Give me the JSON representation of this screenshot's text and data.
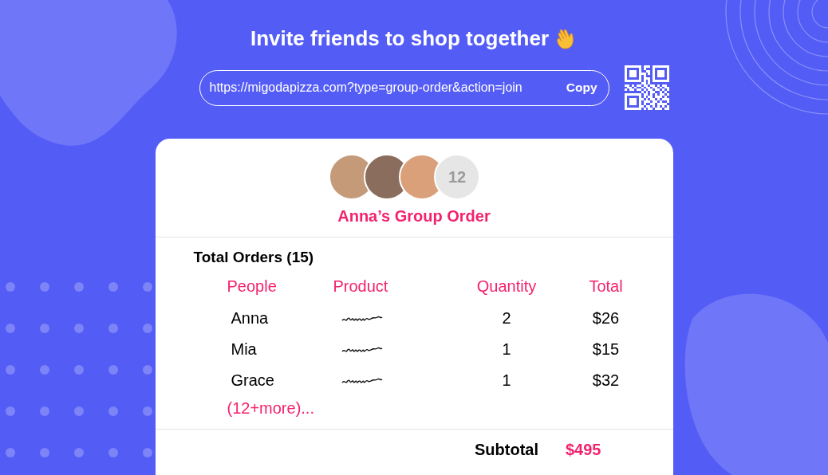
{
  "header": {
    "title": "Invite friends to shop together",
    "link": "https://migodapizza.com?type=group-order&action=join",
    "copy_button": "Copy"
  },
  "group": {
    "avatars": [
      {
        "kind": "photo"
      },
      {
        "kind": "photo"
      },
      {
        "kind": "photo"
      }
    ],
    "more_count": "12",
    "title": "Anna’s Group Order"
  },
  "orders": {
    "heading": "Total Orders (15)",
    "columns": [
      "People",
      "Product",
      "Quantity",
      "Total"
    ],
    "rows": [
      {
        "person": "Anna",
        "quantity": "2",
        "total": "$26"
      },
      {
        "person": "Mia",
        "quantity": "1",
        "total": "$15"
      },
      {
        "person": "Grace",
        "quantity": "1",
        "total": "$32"
      }
    ],
    "more": "(12+more)..."
  },
  "subtotal": {
    "label": "Subtotal",
    "value": "$495"
  }
}
